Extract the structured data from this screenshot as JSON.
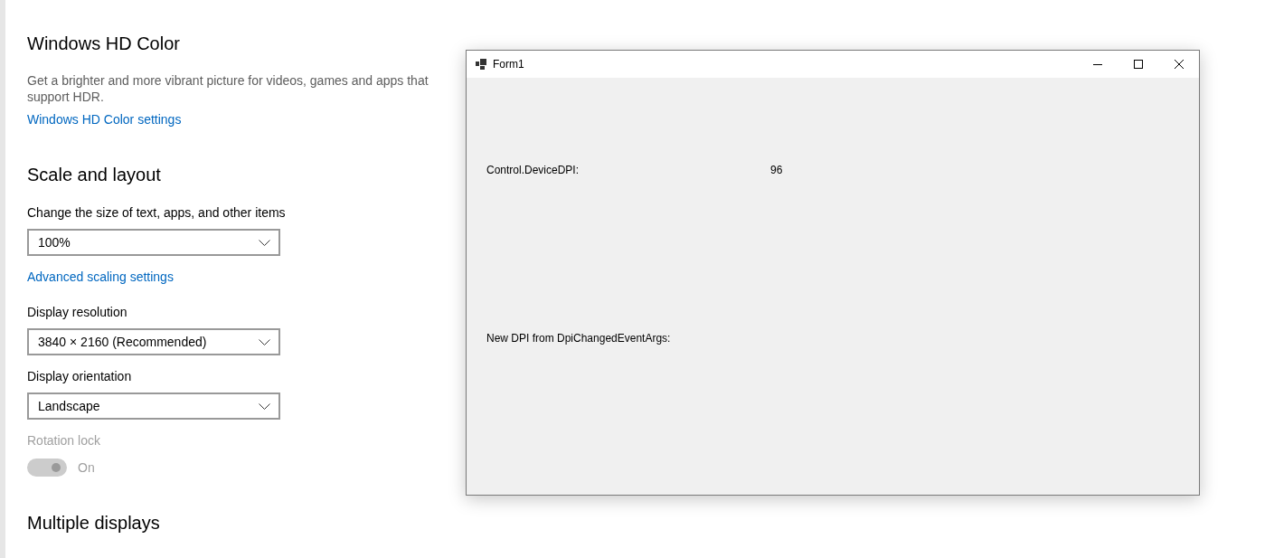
{
  "settings": {
    "sections": [
      {
        "heading": "Windows HD Color",
        "items": [
          {
            "kind": "description",
            "text": "Get a brighter and more vibrant picture for videos, games and apps that support HDR."
          },
          {
            "kind": "link",
            "text": "Windows HD Color settings"
          }
        ]
      },
      {
        "heading": "Scale and layout",
        "items": [
          {
            "kind": "dropdown",
            "label": "Change the size of text, apps, and other items",
            "value": "100%"
          },
          {
            "kind": "link",
            "text": "Advanced scaling settings"
          },
          {
            "kind": "dropdown",
            "label": "Display resolution",
            "value": "3840 × 2160 (Recommended)"
          },
          {
            "kind": "dropdown",
            "label": "Display orientation",
            "value": "Landscape"
          },
          {
            "kind": "toggle",
            "label": "Rotation lock",
            "on": true,
            "disabled": true,
            "state_text": "On"
          }
        ]
      },
      {
        "heading": "Multiple displays"
      }
    ]
  },
  "form_window": {
    "title": "Form1",
    "labels": [
      {
        "text": "Control.DeviceDPI:",
        "value": "96"
      },
      {
        "text": "New DPI from DpiChangedEventArgs:"
      }
    ]
  }
}
